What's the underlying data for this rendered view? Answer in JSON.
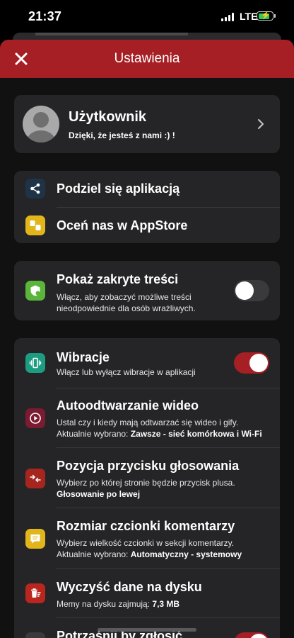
{
  "status_bar": {
    "time": "21:37",
    "network": "LTE",
    "battery_level": 0.85
  },
  "header": {
    "title": "Ustawienia",
    "close_icon": "close-icon"
  },
  "user": {
    "name": "Użytkownik",
    "tagline": "Dzięki, że jesteś z nami :) !"
  },
  "share": {
    "items": [
      {
        "label": "Podziel się aplikacją",
        "icon": "share-icon",
        "color": "#1f3348"
      },
      {
        "label": "Oceń nas w AppStore",
        "icon": "thumbs-icon",
        "color": "#e2b61b"
      }
    ]
  },
  "hidden_content": {
    "title": "Pokaż zakryte treści",
    "description_line1": "Włącz, aby zobaczyć możliwe treści",
    "description_line2": "nieodpowiednie dla osób wrażliwych.",
    "toggle_on": false,
    "icon_color": "#5bb53a"
  },
  "settings": {
    "vibration": {
      "title": "Wibracje",
      "description": "Włącz lub wyłącz wibracje w aplikacji",
      "toggle_on": true,
      "icon_color": "#1e9c82"
    },
    "autoplay": {
      "title": "Autoodtwarzanie wideo",
      "description": "Ustal czy i kiedy mają odtwarzać się wideo i gify.",
      "current_prefix": "Aktualnie wybrano:",
      "current_value": "Zawsze - sieć komórkowa i Wi-Fi",
      "icon_color": "#7b1a30"
    },
    "vote_position": {
      "title": "Pozycja przycisku głosowania",
      "description": "Wybierz po której stronie będzie przycisk plusa.",
      "current_value": "Głosowanie po lewej",
      "icon_color": "#a6261f"
    },
    "comment_font": {
      "title": "Rozmiar czcionki komentarzy",
      "description": "Wybierz wielkość czcionki w sekcji komentarzy.",
      "current_prefix": "Aktualnie wybrano:",
      "current_value": "Automatyczny - systemowy",
      "icon_color": "#e2b61b"
    },
    "clear_data": {
      "title": "Wyczyść dane na dysku",
      "description": "Memy na dysku zajmują:",
      "size": "7,3 MB",
      "icon_color": "#b8261f"
    },
    "shake_report": {
      "title": "Potrząśnij by zgłosić",
      "toggle_on": true
    }
  },
  "accent_color": "#a61f24"
}
